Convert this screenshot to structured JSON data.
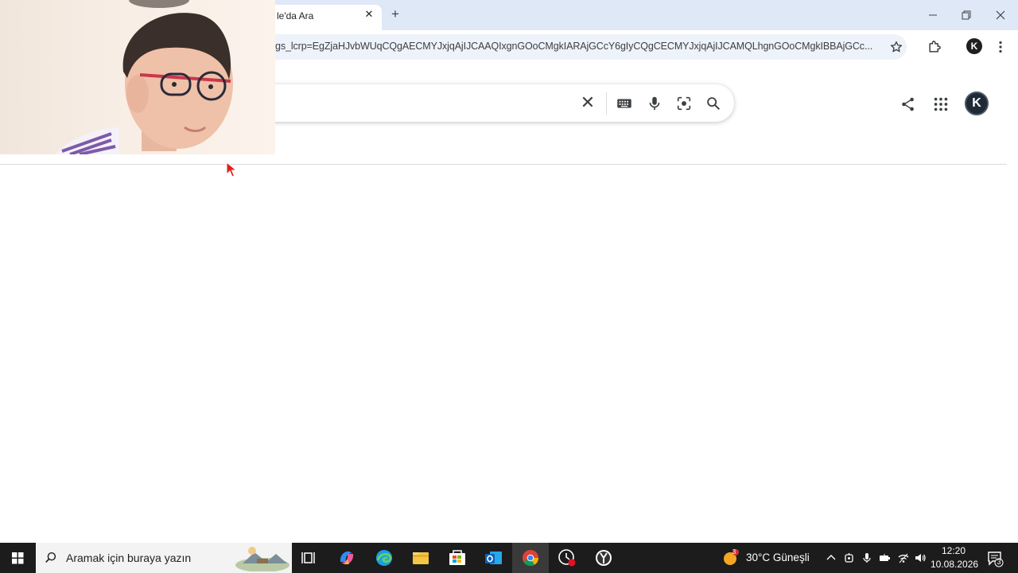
{
  "browser": {
    "tab": {
      "title": "le'da Ara",
      "close_glyph": "✕"
    },
    "new_tab_glyph": "+",
    "address_bar": {
      "url": "gs_lcrp=EgZjaHJvbWUqCQgAECMYJxjqAjIJCAAQIxgnGOoCMgkIARAjGCcY6gIyCQgCECMYJxjqAjIJCAMQLhgnGOoCMgkIBBAjGCc..."
    },
    "profile_initial": "K"
  },
  "google": {
    "clear_glyph": "✕",
    "profile_initial": "K"
  },
  "taskbar": {
    "search_placeholder": "Aramak için buraya yazın",
    "weather": {
      "badge": "3",
      "text": "30°C  Güneşli"
    },
    "clock": {
      "time": "12:20",
      "date": "10.08.2026"
    },
    "notification_count": "3"
  },
  "icons": {
    "tab_close": "close-icon",
    "new_tab": "plus-icon",
    "bookmark": "star-icon",
    "extensions": "puzzle-icon",
    "menu": "kebab-menu-icon",
    "keyboard": "keyboard-icon",
    "voice": "microphone-icon",
    "lens": "camera-lens-icon",
    "search": "search-icon",
    "share": "share-icon",
    "apps": "apps-grid-icon"
  },
  "colors": {
    "tab_strip": "#dfe8f7",
    "taskbar": "#1c1c1c",
    "cursor": "#e0201a"
  }
}
